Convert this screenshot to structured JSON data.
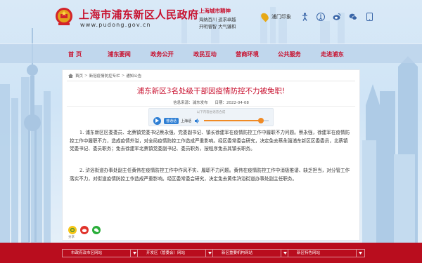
{
  "header": {
    "site_title": "上海市浦东新区人民政府",
    "site_url": "www.pudong.gov.cn",
    "spirit_title": "上海城市精神",
    "spirit_line1": "海纳百川  追求卓越",
    "spirit_line2": "开明睿智  大气谦和",
    "location_label": "浦门印象"
  },
  "nav": {
    "items": [
      "首  页",
      "浦东要闻",
      "政务公开",
      "政民互动",
      "营商环境",
      "公共服务",
      "走进浦东"
    ]
  },
  "breadcrumb": {
    "home": "首页",
    "level1": "新冠疫情防控专栏",
    "level2": "通知公告"
  },
  "article": {
    "title": "浦东新区3名处级干部因疫情防控不力被免职!",
    "source": "信息来源：浦东发布",
    "date": "日期：2022-04-08",
    "player_caption": "以下内容由语音合成",
    "voice_a": "普通话",
    "voice_b": "上海话",
    "progress": 0.88,
    "paragraph1": "1. 浦东新区区委委员、北蔡镇党委书记蔡永强，党委副书记、镇长徐建军在疫情防控工作中履职不力问题。蔡永强，徐建军在疫情防控工作中履职不力，造成疫情外溢，对全局疫情防控工作造成严重影响。经区委常委会研究，决定免去蔡永强浦东新区区委委员，北蔡镇党委书记、委员职务；免去徐建军北蔡镇党委副书记、委员职务，按程序免去其镇长职务。",
    "paragraph2": "2. 浒浴街道办事处副主任黄伟在疫情防控工作中作风不实、履职不力问题。黄伟在疫情防控工作中消极推诿、缺乏担当，对分管工作落实不力，对街道疫情防控工作造成严重影响。经区委常委会研究，决定免去黄伟浒浴街道办事处副主任职务。"
  },
  "share": {
    "label": "分享"
  },
  "footer": {
    "links": [
      "市政府及市区网站",
      "开发区（管委会）网站",
      "新区重要机构网站",
      "新区特色网站"
    ]
  },
  "colors": {
    "brand_red": "#c8102e",
    "footer_red": "#b90d1e",
    "accent_blue": "#2f7fd4",
    "accent_orange": "#f08a24"
  }
}
